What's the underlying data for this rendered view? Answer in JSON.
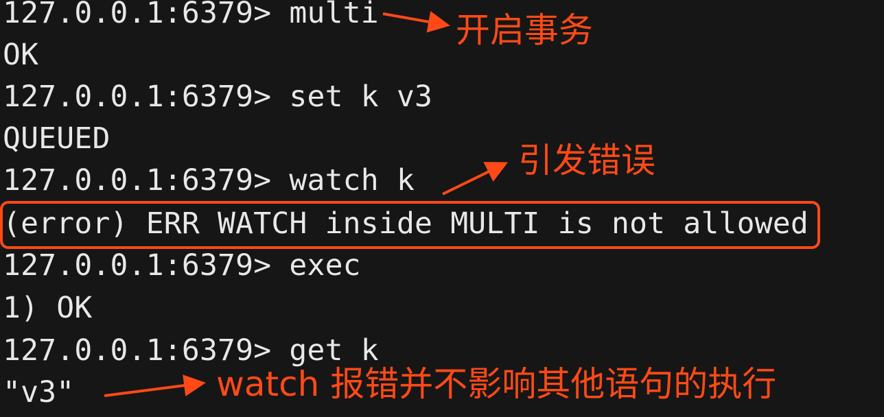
{
  "terminal": {
    "lines": [
      "127.0.0.1:6379> multi",
      "OK",
      "127.0.0.1:6379> set k v3",
      "QUEUED",
      "127.0.0.1:6379> watch k",
      "(error) ERR WATCH inside MULTI is not allowed",
      "127.0.0.1:6379> exec",
      "1) OK",
      "127.0.0.1:6379> get k",
      "\"v3\""
    ]
  },
  "annotations": {
    "start_transaction": "开启事务",
    "cause_error": "引发错误",
    "note": "watch 报错并不影响其他语句的执行"
  },
  "colors": {
    "background": "#161616",
    "text": "#e8e8e8",
    "accent": "#ff4a17"
  }
}
